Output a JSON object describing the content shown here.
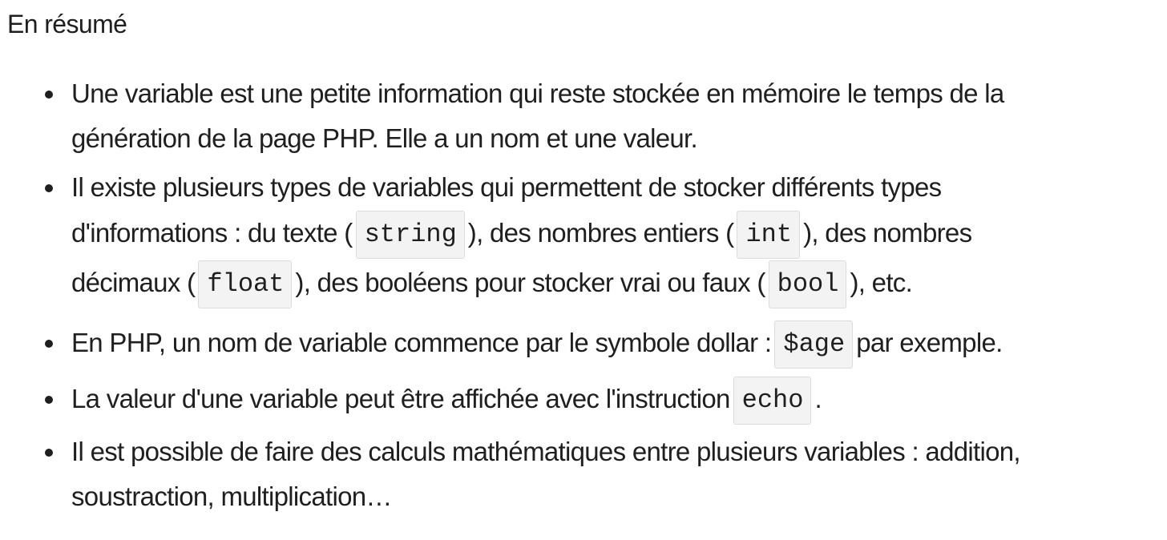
{
  "summary": {
    "title": "En résumé",
    "items": [
      {
        "line1": "Une variable est une petite information qui reste stockée en mémoire le temps de la",
        "line2": "génération de la page PHP. Elle a un nom et une valeur."
      },
      {
        "line1": "Il existe plusieurs types de variables qui permettent de stocker différents types",
        "text_a": "d'informations : du texte (",
        "code_string": "string",
        "text_b": "), des nombres entiers (",
        "code_int": "int",
        "text_c": "), des nombres",
        "text_d": "décimaux (",
        "code_float": "float",
        "text_e": "), des booléens pour stocker vrai ou faux (",
        "code_bool": "bool",
        "text_f": "), etc."
      },
      {
        "text_a": "En PHP, un nom de variable commence par le symbole dollar :",
        "code_age": "$age",
        "text_b": "par exemple."
      },
      {
        "text_a": "La valeur d'une variable peut être affichée avec l'instruction",
        "code_echo": "echo",
        "text_b": "."
      },
      {
        "line1": "Il est possible de faire des calculs mathématiques entre plusieurs variables : addition,",
        "line2": "soustraction, multiplication…"
      }
    ]
  }
}
